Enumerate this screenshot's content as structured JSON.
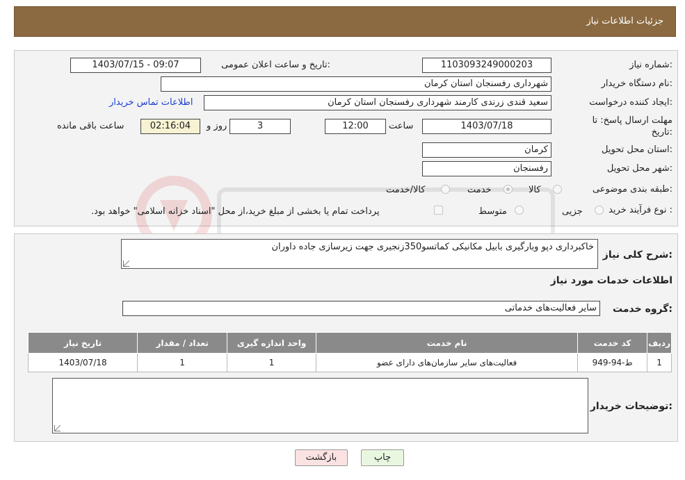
{
  "header": {
    "title": "جزئیات اطلاعات نیاز"
  },
  "form": {
    "need_number_label": "شماره نیاز:",
    "need_number": "1103093249000203",
    "announce_label": "تاریخ و ساعت اعلان عمومی:",
    "announce_value": "1403/07/15 - 09:07",
    "buyer_org_label": "نام دستگاه خریدار:",
    "buyer_org": "شهرداری رفسنجان استان کرمان",
    "requester_label": "ایجاد کننده درخواست:",
    "requester": "سعید قندی زرندی کارمند شهرداری رفسنجان استان کرمان",
    "contact_link": "اطلاعات تماس خریدار",
    "deadline_label_1": "مهلت ارسال پاسخ: تا",
    "deadline_label_2": "تاریخ:",
    "deadline_date": "1403/07/18",
    "time_label": "ساعت",
    "deadline_time": "12:00",
    "days_value": "3",
    "days_label": "روز و",
    "remaining_time": "02:16:04",
    "remaining_label": "ساعت باقی مانده",
    "province_label": "استان محل تحویل:",
    "province": "کرمان",
    "city_label": "شهر محل تحویل:",
    "city": "رفسنجان",
    "category_label": "طبقه بندی موضوعی:",
    "category_options": [
      "کالا",
      "خدمت",
      "کالا/خدمت"
    ],
    "category_selected": "خدمت",
    "purchase_type_label": "نوع فرآیند خرید :",
    "purchase_options": [
      "جزیی",
      "متوسط"
    ],
    "purchase_note": "پرداخت تمام یا بخشی از مبلغ خرید،از محل \"اسناد خزانه اسلامی\" خواهد بود."
  },
  "details": {
    "summary_label": "شرح کلی نیاز:",
    "summary": "خاکبرداری دپو وبارگیری بابیل مکانیکی کماتسو350زنجیری جهت زیرسازی جاده داوران",
    "services_title": "اطلاعات خدمات مورد نیاز",
    "service_group_label": "گروه خدمت:",
    "service_group": "سایر فعالیت‌های خدماتی",
    "table": {
      "headers": [
        "ردیف",
        "کد خدمت",
        "نام خدمت",
        "واحد اندازه گیری",
        "تعداد / مقدار",
        "تاریخ نیاز"
      ],
      "rows": [
        [
          "1",
          "ط-94-949",
          "فعالیت‌های سایر سازمان‌های دارای عضو",
          "1",
          "1",
          "1403/07/18"
        ]
      ]
    },
    "buyer_notes_label": "توضیحات خریدار:",
    "buyer_notes": ""
  },
  "buttons": {
    "print": "چاپ",
    "back": "بازگشت"
  },
  "colors": {
    "header_bg": "#8b6a41",
    "table_header_bg": "#8a8a8a",
    "link": "#1a3fd1"
  }
}
